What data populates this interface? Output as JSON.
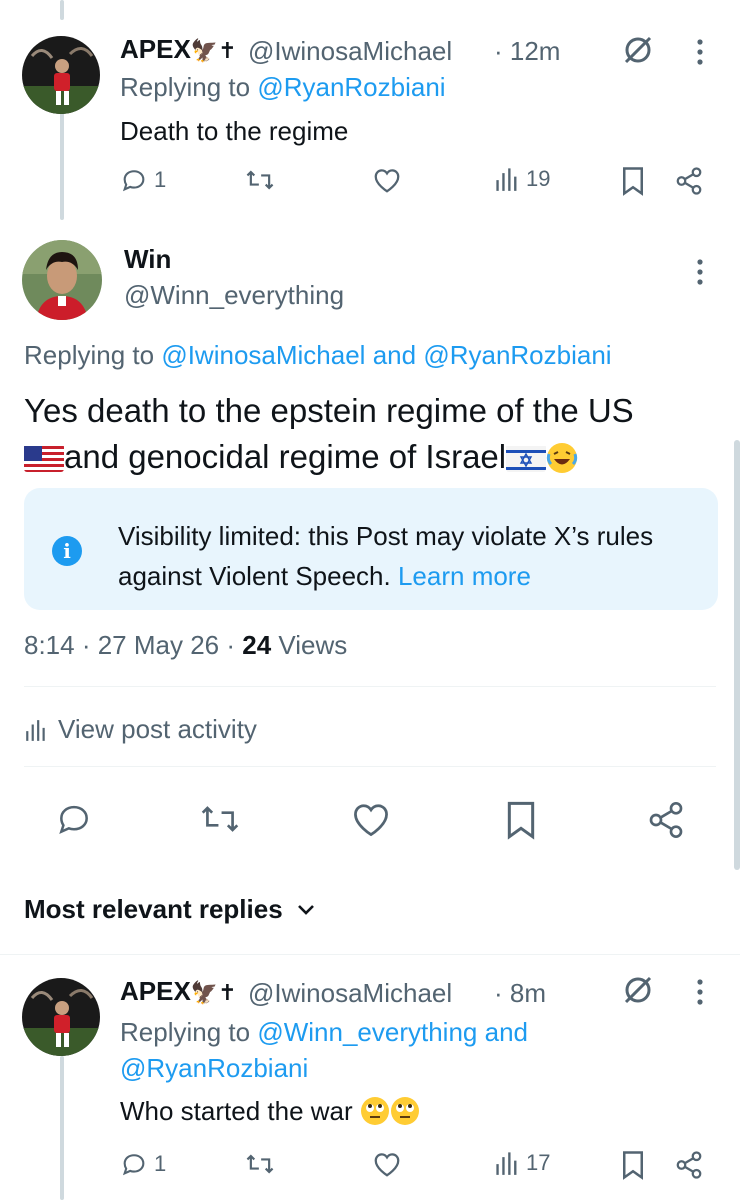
{
  "post1": {
    "name": "APEX",
    "name_glyphs": "🦅✝",
    "handle": "@IwinosaMichael",
    "time": "· 12m",
    "replying_prefix": "Replying to",
    "replying_to": "@RyanRozbiani",
    "text": "Death to the regime",
    "replies": "1",
    "views": "19"
  },
  "main_post": {
    "name": "Win",
    "handle": "@Winn_everything",
    "replying_prefix": "Replying to",
    "replying_to_1": "@IwinosaMichael",
    "replying_and": "and",
    "replying_to_2": "@RyanRozbiani",
    "text_line1": "Yes death to the epstein regime of the US",
    "text_line2": "and genocidal regime of Israel",
    "notice_text": "Visibility limited: this Post may violate X’s rules against Violent Speech.",
    "notice_link": "Learn more",
    "time": "8:14 · 27 May 26 · ",
    "views_count": "24",
    "views_label": "Views",
    "activity_label": "View post activity"
  },
  "replies_header": {
    "label": "Most relevant replies"
  },
  "post2": {
    "name": "APEX",
    "handle": "@IwinosaMichael",
    "time": "· 8m",
    "replying_prefix": "Replying to",
    "replying_to_1": "@Winn_everything",
    "replying_and": "and",
    "replying_to_2": "@RyanRozbiani",
    "text": "Who started the war",
    "replies": "1",
    "views": "17"
  },
  "colors": {
    "accent": "#1d9bf0",
    "muted": "#536471",
    "notice_bg": "#e8f5fd"
  }
}
